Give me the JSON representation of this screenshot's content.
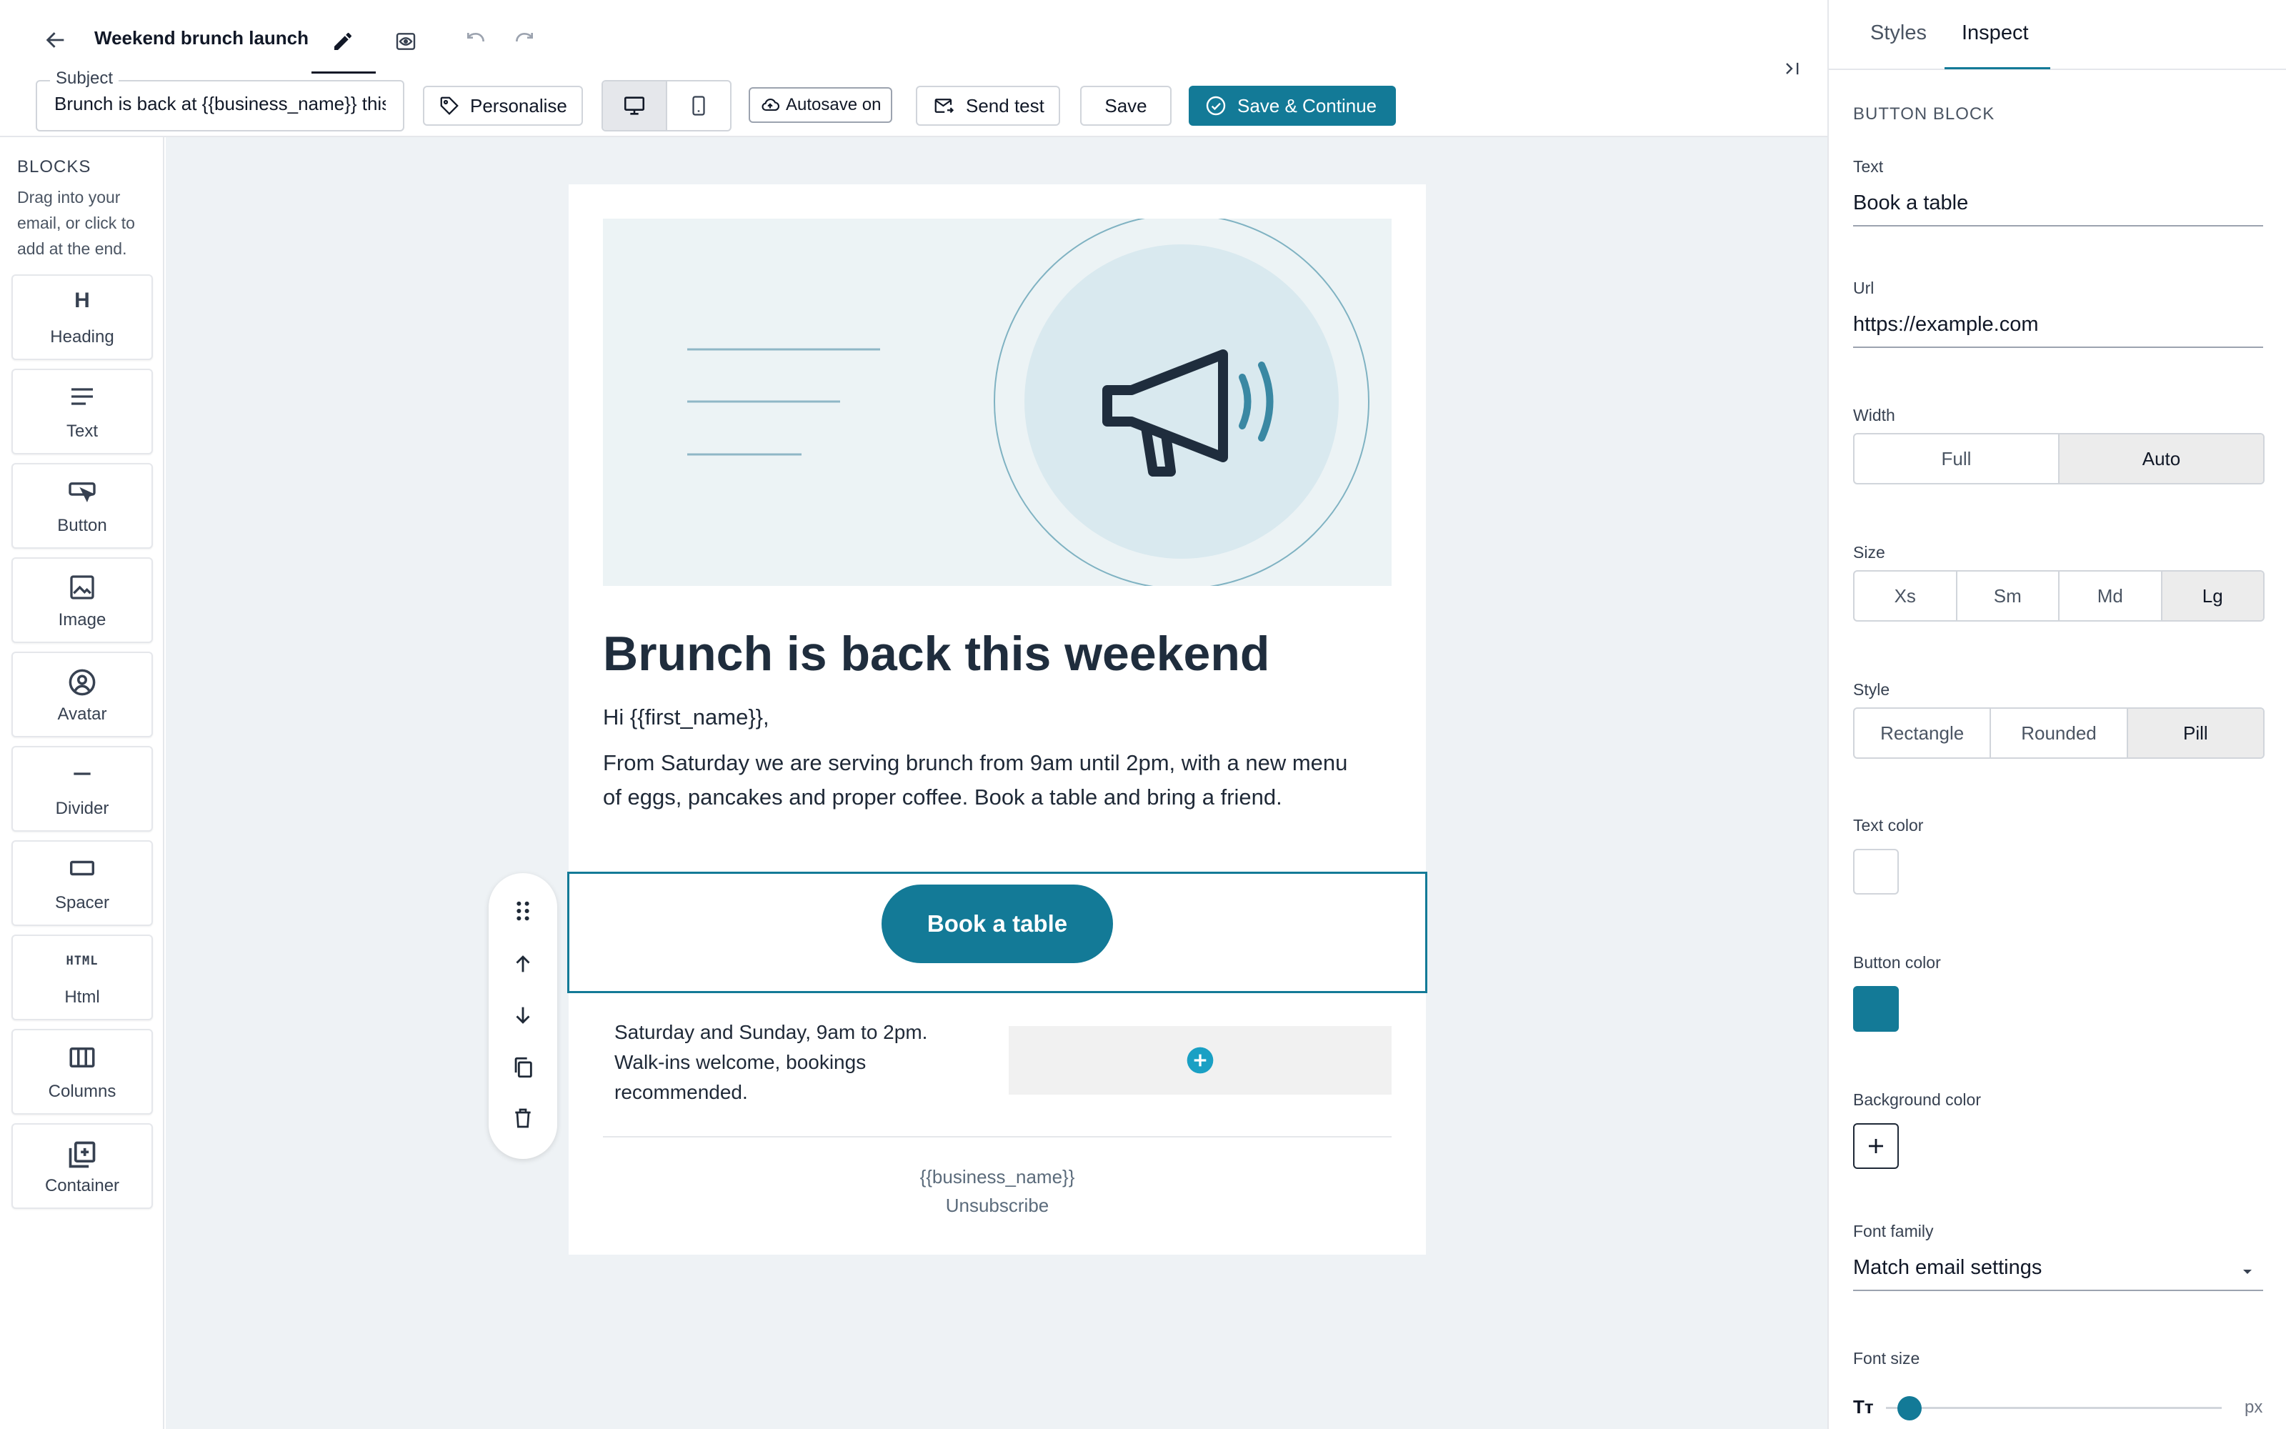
{
  "header": {
    "title": "Weekend brunch launch",
    "subject_label": "Subject",
    "subject_value": "Brunch is back at {{business_name}} this weekend",
    "personalise_label": "Personalise",
    "autosave_label": "Autosave on",
    "send_test_label": "Send test",
    "save_label": "Save",
    "save_continue_label": "Save & Continue",
    "accent_color": "#137a97"
  },
  "blocks_panel": {
    "title": "BLOCKS",
    "hint": "Drag into your email, or click to add at the end.",
    "items": [
      {
        "label": "Heading",
        "icon": "heading-icon"
      },
      {
        "label": "Text",
        "icon": "text-icon"
      },
      {
        "label": "Button",
        "icon": "button-icon"
      },
      {
        "label": "Image",
        "icon": "image-icon"
      },
      {
        "label": "Avatar",
        "icon": "avatar-icon"
      },
      {
        "label": "Divider",
        "icon": "divider-icon"
      },
      {
        "label": "Spacer",
        "icon": "spacer-icon"
      },
      {
        "label": "Html",
        "icon": "html-icon"
      },
      {
        "label": "Columns",
        "icon": "columns-icon"
      },
      {
        "label": "Container",
        "icon": "container-icon"
      }
    ],
    "heading_glyph": "H",
    "html_glyph": "HTML"
  },
  "email": {
    "headline": "Brunch is back this weekend",
    "greeting": "Hi {{first_name}},",
    "body": "From Saturday we are serving brunch from 9am until 2pm, with a new menu of eggs, pancakes and proper coffee. Book a table and bring a friend.",
    "button_text": "Book a table",
    "hours": "Saturday and Sunday, 9am to 2pm. Walk-ins welcome, bookings recommended.",
    "footer_business": "{{business_name}}",
    "footer_unsubscribe": "Unsubscribe"
  },
  "inspector": {
    "tabs": [
      "Styles",
      "Inspect"
    ],
    "active_tab": "Inspect",
    "section_title": "BUTTON BLOCK",
    "text_label": "Text",
    "text_value": "Book a table",
    "url_label": "Url",
    "url_value": "https://example.com",
    "width_label": "Width",
    "width_options": [
      "Full",
      "Auto"
    ],
    "width_selected": "Auto",
    "size_label": "Size",
    "size_options": [
      "Xs",
      "Sm",
      "Md",
      "Lg"
    ],
    "size_selected": "Lg",
    "style_label": "Style",
    "style_options": [
      "Rectangle",
      "Rounded",
      "Pill"
    ],
    "style_selected": "Pill",
    "text_color_label": "Text color",
    "text_color": "#ffffff",
    "button_color_label": "Button color",
    "button_color": "#137a97",
    "background_color_label": "Background color",
    "font_family_label": "Font family",
    "font_family_value": "Match email settings",
    "font_size_label": "Font size",
    "font_size_unit": "px",
    "font_size_glyph": "Tт"
  }
}
